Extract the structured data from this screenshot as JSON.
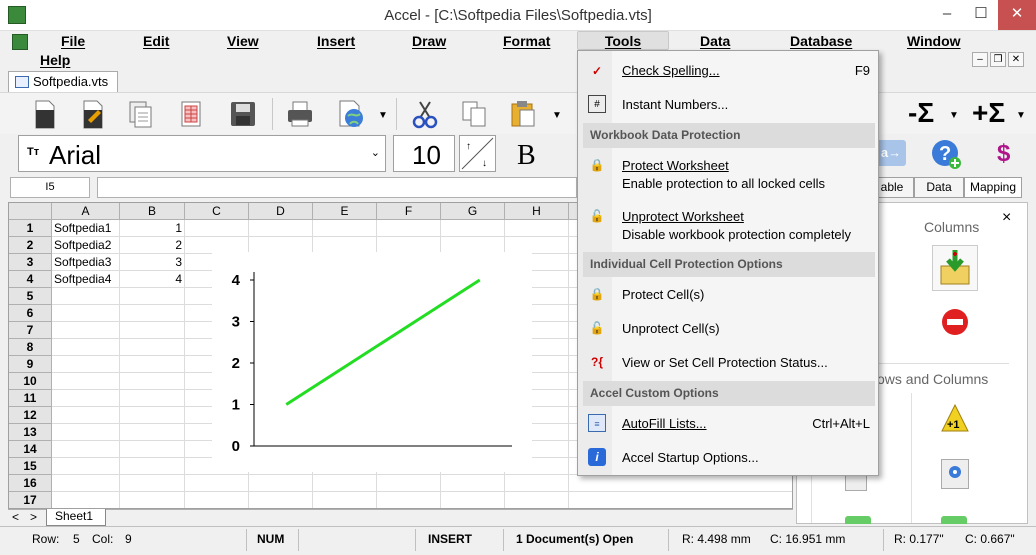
{
  "window": {
    "title": "Accel - [C:\\Softpedia Files\\Softpedia.vts]",
    "minimize": "–",
    "maximize": "☐",
    "close": "✕"
  },
  "menubar": {
    "items": [
      "File",
      "Edit",
      "View",
      "Insert",
      "Draw",
      "Format",
      "Tools",
      "Data",
      "Database",
      "Window",
      "Help"
    ]
  },
  "mdi": {
    "minimize": "–",
    "restore": "❐",
    "close": "✕"
  },
  "doc_tab": "Softpedia.vts",
  "font": {
    "name": "Arial",
    "size": "10",
    "bold_label": "B"
  },
  "formula_bar": {
    "cell_ref": "I5",
    "value": ""
  },
  "grid": {
    "columns": [
      "A",
      "B",
      "C",
      "D",
      "E",
      "F",
      "G",
      "H"
    ],
    "rows": [
      "1",
      "2",
      "3",
      "4",
      "5",
      "6",
      "7",
      "8",
      "9",
      "10",
      "11",
      "12",
      "13",
      "14",
      "15",
      "16",
      "17"
    ],
    "data": [
      {
        "a": "Softpedia1",
        "b": "1"
      },
      {
        "a": "Softpedia2",
        "b": "2"
      },
      {
        "a": "Softpedia3",
        "b": "3"
      },
      {
        "a": "Softpedia4",
        "b": "4"
      }
    ]
  },
  "chart_data": {
    "type": "line",
    "x": [
      1,
      2,
      3,
      4
    ],
    "series": [
      {
        "values": [
          1,
          2,
          3,
          4
        ],
        "color": "#22dd22"
      }
    ],
    "ytick_labels": [
      "0",
      "1",
      "2",
      "3",
      "4"
    ],
    "ylim": [
      0,
      4
    ],
    "grid": false
  },
  "sheet_tabs": {
    "nav_prev": "<",
    "nav_next": ">",
    "tab": "Sheet1"
  },
  "statusbar": {
    "row_label": "Row:",
    "row": "5",
    "col_label": "Col:",
    "col": "9",
    "num": "NUM",
    "insert": "INSERT",
    "docs": "1 Document(s) Open",
    "r_mm": "R: 4.498 mm",
    "c_mm": "C: 16.951 mm",
    "r_in": "R: 0.177\"",
    "c_in": "C: 0.667\""
  },
  "right_panel": {
    "tabs": [
      "able",
      "Data",
      "Mapping"
    ],
    "close": "×",
    "columns_label": "Columns",
    "rows_cols_label": "ows and Columns"
  },
  "tools_menu": {
    "check_spelling": {
      "label": "Check Spelling...",
      "shortcut": "F9"
    },
    "instant_numbers": "Instant Numbers...",
    "hdr_workbook": "Workbook Data Protection",
    "protect_ws": {
      "label": "Protect Worksheet",
      "desc": "Enable protection to all locked cells"
    },
    "unprotect_ws": {
      "label": "Unprotect Worksheet",
      "desc": "Disable workbook protection completely"
    },
    "hdr_cell": "Individual Cell Protection Options",
    "protect_cells": "Protect Cell(s)",
    "unprotect_cells": "Unprotect Cell(s)",
    "view_status": "View or Set Cell Protection Status...",
    "hdr_custom": "Accel Custom Options",
    "autofill": {
      "label": "AutoFill Lists...",
      "shortcut": "Ctrl+Alt+L"
    },
    "startup": "Accel Startup Options..."
  }
}
